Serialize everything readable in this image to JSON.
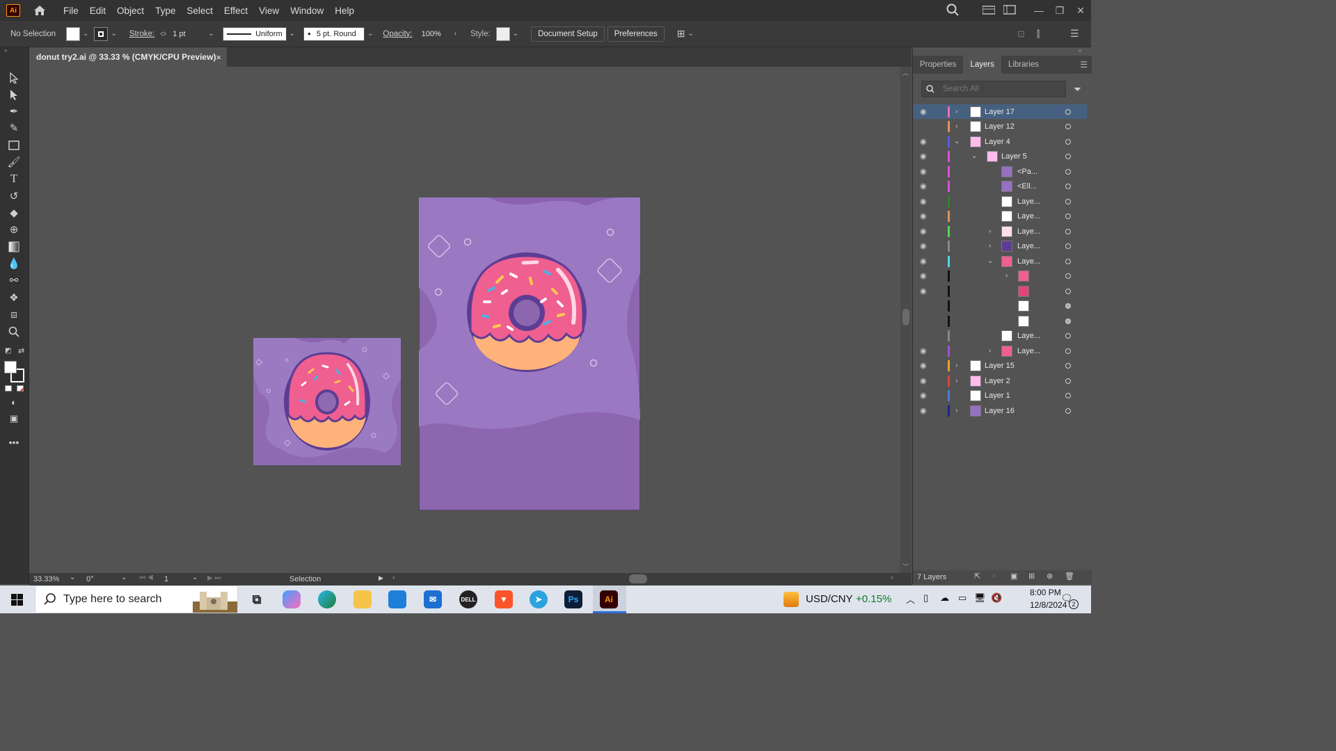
{
  "app": {
    "logo": "Ai"
  },
  "menu": [
    "File",
    "Edit",
    "Object",
    "Type",
    "Select",
    "Effect",
    "View",
    "Window",
    "Help"
  ],
  "control_bar": {
    "selection": "No Selection",
    "stroke_label": "Stroke:",
    "stroke_weight": "1 pt",
    "profile": "Uniform",
    "brush": "5 pt. Round",
    "opacity_label": "Opacity:",
    "opacity": "100%",
    "style_label": "Style:",
    "doc_setup": "Document Setup",
    "preferences": "Preferences"
  },
  "document_tab": {
    "title": "donut try2.ai @ 33.33 % (CMYK/CPU Preview)",
    "close": "×"
  },
  "status": {
    "zoom": "33.33%",
    "rotation": "0°",
    "artboard": "1",
    "tool": "Selection"
  },
  "panel": {
    "tabs": [
      "Properties",
      "Layers",
      "Libraries"
    ],
    "search_placeholder": "Search All",
    "footer": "7 Layers",
    "layers": [
      {
        "name": "Layer 17",
        "color": "#e86fb0"
      },
      {
        "name": "Layer 12",
        "color": "#e0915a"
      },
      {
        "name": "Layer 4",
        "color": "#5a5af0"
      },
      {
        "name": "Layer 5",
        "color": "#e04fd8"
      },
      {
        "name": "<Pa...",
        "color": "#e04fd8"
      },
      {
        "name": "<Ell...",
        "color": "#e04fd8"
      },
      {
        "name": "Laye...",
        "color": "#2a8a2a"
      },
      {
        "name": "Laye...",
        "color": "#e0915a"
      },
      {
        "name": "Laye...",
        "color": "#4fd84f"
      },
      {
        "name": "Laye...",
        "color": "#888888"
      },
      {
        "name": "Laye...",
        "color": "#4fd8e0"
      },
      {
        "name": "",
        "color": "#111111"
      },
      {
        "name": "",
        "color": "#111111"
      },
      {
        "name": "",
        "color": "#111111"
      },
      {
        "name": "",
        "color": "#111111"
      },
      {
        "name": "Laye...",
        "color": "#888888"
      },
      {
        "name": "Laye...",
        "color": "#a24fd8"
      },
      {
        "name": "Layer 15",
        "color": "#f0a020"
      },
      {
        "name": "Layer 2",
        "color": "#e04040"
      },
      {
        "name": "Layer 1",
        "color": "#4f7ae0"
      },
      {
        "name": "Layer 16",
        "color": "#20209a"
      }
    ]
  },
  "taskbar": {
    "search_placeholder": "Type here to search",
    "ticker": "USD/CNY",
    "ticker_change": "+0.15%",
    "time": "8:00 PM",
    "date": "12/8/2024",
    "notifications": "2"
  },
  "colors": {
    "accent": "#46607f",
    "artboard_bg": "#9478bb",
    "donut_pink": "#ee5f8e"
  }
}
